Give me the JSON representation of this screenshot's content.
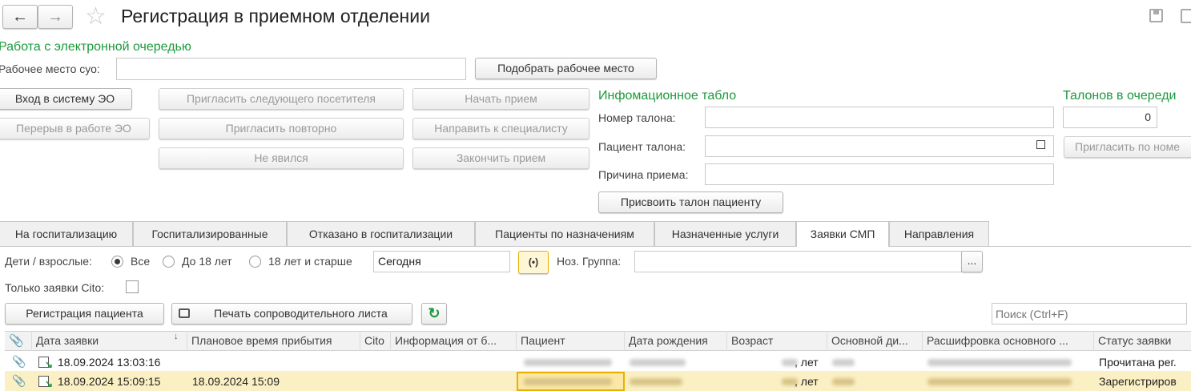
{
  "window": {
    "title": "Регистрация в приемном отделении"
  },
  "queue": {
    "section_title": "Работа с электронной очередью",
    "workplace_label": "Рабочее место суо:",
    "workplace_value": "",
    "pick_workplace_button": "Подобрать рабочее место",
    "login_button": "Вход в систему ЭО",
    "break_button": "Перерыв в работе ЭО",
    "invite_next_button": "Пригласить следующего посетителя",
    "invite_again_button": "Пригласить повторно",
    "no_show_button": "Не явился",
    "start_button": "Начать прием",
    "refer_button": "Направить к специалисту",
    "finish_button": "Закончить прием"
  },
  "board": {
    "title": "Инфомационное табло",
    "ticket_number_label": "Номер талона:",
    "ticket_patient_label": "Пациент талона:",
    "reason_label": "Причина приема:",
    "assign_button": "Присвоить талон пациенту"
  },
  "tickets": {
    "title": "Талонов в очереди",
    "count": "0",
    "invite_by_number_button": "Пригласить по номе"
  },
  "tabs": [
    {
      "label": "На госпитализацию"
    },
    {
      "label": "Госпитализированные"
    },
    {
      "label": "Отказано в госпитализации"
    },
    {
      "label": "Пациенты по назначениям"
    },
    {
      "label": "Назначенные услуги"
    },
    {
      "label": "Заявки СМП"
    },
    {
      "label": "Направления"
    }
  ],
  "active_tab": "Заявки СМП",
  "filters": {
    "age_label": "Дети / взрослые:",
    "age_options": [
      "Все",
      "До 18 лет",
      "18 лет и старше"
    ],
    "age_selected": "Все",
    "period_value": "Сегодня",
    "noz_group_label": "Ноз. Группа:",
    "noz_group_value": "",
    "cito_only_label": "Только заявки Cito:",
    "cito_only_checked": false
  },
  "toolbar": {
    "register_button": "Регистрация пациента",
    "print_button": "Печать сопроводительного листа",
    "search_placeholder": "Поиск (Ctrl+F)"
  },
  "table": {
    "columns": [
      "Дата заявки",
      "Плановое время прибытия",
      "Cito",
      "Информация от б...",
      "Пациент",
      "Дата рождения",
      "Возраст",
      "Основной ди...",
      "Расшифровка основного ...",
      "Статус заявки"
    ],
    "rows": [
      {
        "date": "18.09.2024 13:03:16",
        "planned": "",
        "cito": "",
        "info": "",
        "patient": "",
        "birth": "",
        "age": ", лет",
        "diag": "",
        "diag_desc": "",
        "status": "Прочитана рег."
      },
      {
        "date": "18.09.2024 15:09:15",
        "planned": "18.09.2024 15:09",
        "cito": "",
        "info": "",
        "patient": "",
        "birth": "",
        "age": ", лет",
        "diag": "",
        "diag_desc": "",
        "status": "Зарегистриров"
      }
    ]
  },
  "colors": {
    "accent_green": "#1c9a3c",
    "selected_row": "#fbf0c4",
    "selected_cell_border": "#e8b100"
  }
}
